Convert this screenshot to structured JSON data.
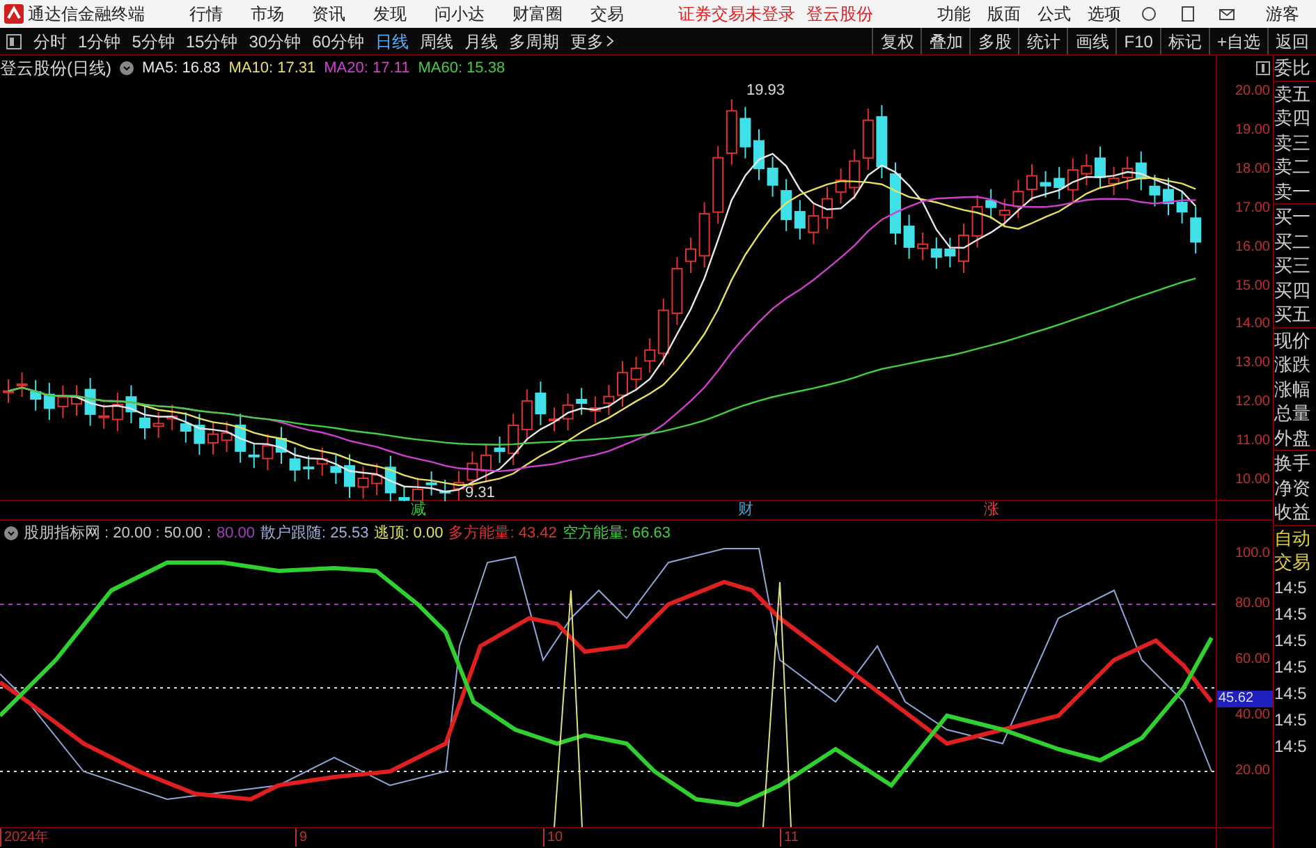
{
  "top_bar": {
    "app_title": "通达信金融终端",
    "menu": [
      "行情",
      "市场",
      "资讯",
      "发现",
      "问小达",
      "财富圈",
      "交易"
    ],
    "notice": "证券交易未登录",
    "stock": "登云股份",
    "right_menu": [
      "功能",
      "版面",
      "公式",
      "选项"
    ],
    "user": "游客"
  },
  "toolbar": {
    "periods": [
      {
        "label": "分时",
        "selected": false
      },
      {
        "label": "1分钟",
        "selected": false
      },
      {
        "label": "5分钟",
        "selected": false
      },
      {
        "label": "15分钟",
        "selected": false
      },
      {
        "label": "30分钟",
        "selected": false
      },
      {
        "label": "60分钟",
        "selected": false
      },
      {
        "label": "日线",
        "selected": true
      },
      {
        "label": "周线",
        "selected": false
      },
      {
        "label": "月线",
        "selected": false
      },
      {
        "label": "多周期",
        "selected": false
      }
    ],
    "more": "更多",
    "actions": [
      "复权",
      "叠加",
      "多股",
      "统计",
      "画线",
      "F10",
      "标记",
      "+自选",
      "返回"
    ]
  },
  "price_chart": {
    "title": "登云股份(日线)",
    "ma": [
      {
        "label": "MA5: 16.83",
        "color": "#e8e8e8"
      },
      {
        "label": "MA10: 17.31",
        "color": "#e8e060"
      },
      {
        "label": "MA20: 17.11",
        "color": "#d040d0"
      },
      {
        "label": "MA60: 15.38",
        "color": "#40d040"
      }
    ],
    "high_label": "19.93",
    "low_label": "9.31",
    "y_ticks": [
      "20.00",
      "19.00",
      "18.00",
      "17.00",
      "16.00",
      "15.00",
      "14.00",
      "13.00",
      "12.00",
      "11.00",
      "10.00"
    ],
    "markers": [
      {
        "label": "减",
        "color": "#40c040"
      },
      {
        "label": "财",
        "color": "#40a0d0"
      },
      {
        "label": "涨",
        "color": "#e04040"
      }
    ]
  },
  "indicator": {
    "legend": [
      {
        "text": "股朋指标网 : 20.00 : 50.00 :",
        "color": "#c8c8c8"
      },
      {
        "text": "80.00",
        "color": "#a040c0"
      },
      {
        "text": "散户跟随: 25.53",
        "color": "#a0b0e0"
      },
      {
        "text": "逃顶: 0.00",
        "color": "#e0e060"
      },
      {
        "text": "多方能量: 43.42",
        "color": "#e03030"
      },
      {
        "text": "空方能量: 66.63",
        "color": "#40d040"
      }
    ],
    "y_ticks": [
      "100.0",
      "80.00",
      "60.00",
      "40.00",
      "20.00"
    ],
    "cursor_value": "45.62"
  },
  "date_axis": [
    "2024年",
    "9",
    "10",
    "11"
  ],
  "right_panel": {
    "quote_labels": [
      "委比",
      "卖五",
      "卖四",
      "卖三",
      "卖二",
      "卖一",
      "买一",
      "买二",
      "买三",
      "买四",
      "买五",
      "现价",
      "涨跌",
      "涨幅",
      "总量",
      "外盘",
      "换手",
      "净资",
      "收益"
    ],
    "auto_trade": [
      "自动",
      "交易"
    ],
    "times": [
      "14:5",
      "14:5",
      "14:5",
      "14:5",
      "14:5",
      "14:5",
      "14:5"
    ]
  }
}
